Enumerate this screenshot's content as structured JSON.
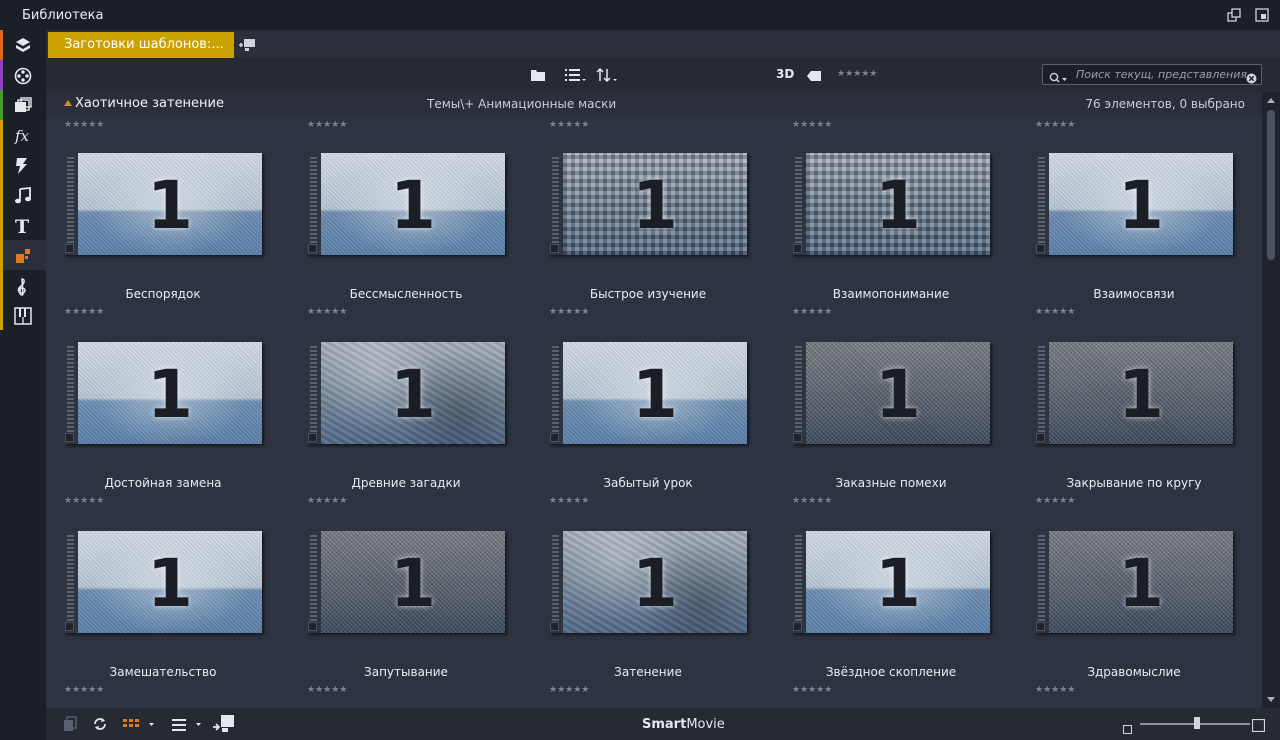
{
  "window": {
    "title": "Библиотека"
  },
  "sidebar": {
    "items": [
      {
        "icon": "project-bin-icon",
        "stripe": "#d96a1c"
      },
      {
        "icon": "film-reel-icon",
        "stripe": "#8f3fbf"
      },
      {
        "icon": "stacked-pages-icon",
        "stripe": "#4a9a34"
      },
      {
        "icon": "effects-fx-icon",
        "stripe": "#c9a100"
      },
      {
        "icon": "lightning-icon",
        "stripe": "#c9a100"
      },
      {
        "icon": "music-note-icon",
        "stripe": "#c9a100"
      },
      {
        "icon": "title-text-icon",
        "stripe": "#c9a100"
      },
      {
        "icon": "montage-template-icon",
        "stripe": "#c9a100"
      },
      {
        "icon": "treble-clef-icon",
        "stripe": "#c9a100"
      },
      {
        "icon": "piano-keys-icon",
        "stripe": "#c9a100"
      }
    ]
  },
  "tabs": {
    "active_label": "Заготовки шаблонов:..."
  },
  "toolbar": {
    "label_3d": "3D",
    "search_placeholder": "Поиск текущ, представления"
  },
  "group": {
    "title": "Хаотичное затенение",
    "path": "Темы\\+ Анимационные маски",
    "count": "76 элементов, 0 выбрано"
  },
  "rating_stars": "★★★★★",
  "items": [
    {
      "label": "Беспорядок",
      "texture": "light"
    },
    {
      "label": "Бессмысленность",
      "texture": "light"
    },
    {
      "label": "Быстрое изучение",
      "texture": "pixel"
    },
    {
      "label": "Взаимопонимание",
      "texture": "pixel"
    },
    {
      "label": "Взаимосвязи",
      "texture": "light"
    },
    {
      "label": "Достойная замена",
      "texture": "light"
    },
    {
      "label": "Древние загадки",
      "texture": "blur"
    },
    {
      "label": "Забытый урок",
      "texture": "light"
    },
    {
      "label": "Заказные помехи",
      "texture": "dark"
    },
    {
      "label": "Закрывание по кругу",
      "texture": "dark"
    },
    {
      "label": "Замешательство",
      "texture": "light"
    },
    {
      "label": "Запутывание",
      "texture": "dark"
    },
    {
      "label": "Затенение",
      "texture": "blur"
    },
    {
      "label": "Звёздное скопление",
      "texture": "light"
    },
    {
      "label": "Здравомыслие",
      "texture": "dark"
    }
  ],
  "thumb_number": "1",
  "bottombar": {
    "brand_bold": "Smart",
    "brand_rest": "Movie"
  }
}
